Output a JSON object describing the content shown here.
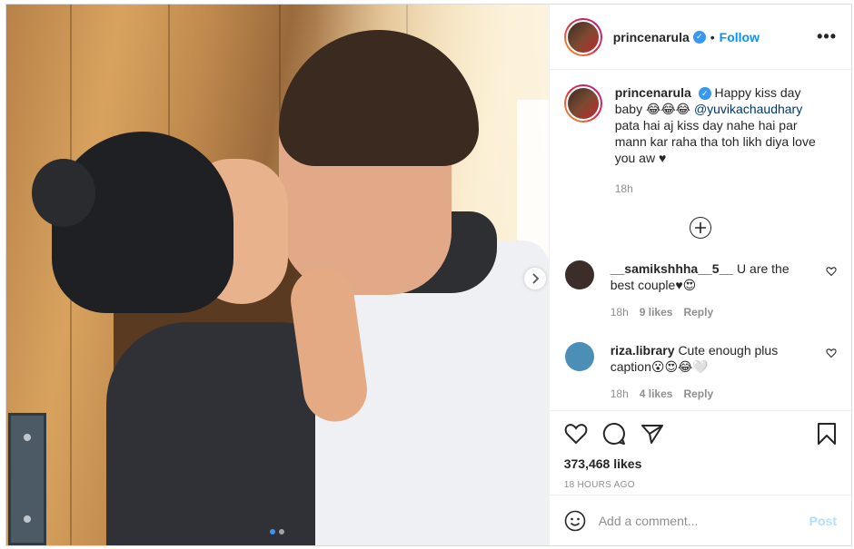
{
  "header": {
    "username": "princenarula",
    "separator": "•",
    "follow_label": "Follow",
    "more_icon": "more-horizontal-icon"
  },
  "caption": {
    "username": "princenarula",
    "text_before": "Happy kiss day baby 😂😂😂 ",
    "mention": "@yuvikachaudhary",
    "text_after": " pata hai aj kiss day nahe hai par mann kar raha tha toh likh diya love you aw ♥",
    "age": "18h"
  },
  "load_more_icon": "plus-circle-icon",
  "comments": [
    {
      "username": "__samikshhha__5__",
      "text": "U are the best couple♥😍",
      "age": "18h",
      "likes": "9 likes",
      "reply_label": "Reply",
      "avatar_color": "#3a2d2a"
    },
    {
      "username": "riza.library",
      "text": "Cute enough plus caption😮😍😂🤍",
      "age": "18h",
      "likes": "4 likes",
      "reply_label": "Reply",
      "avatar_color": "#4b8fb6"
    }
  ],
  "actions": {
    "likes": "373,468 likes",
    "timestamp": "18 HOURS AGO"
  },
  "add_comment": {
    "placeholder": "Add a comment...",
    "post_label": "Post"
  },
  "carousel": {
    "next_icon": "chevron-right-icon",
    "total_slides": 2,
    "active_slide": 1
  },
  "colors": {
    "accent": "#0095f6",
    "verified": "#3897f0",
    "post_disabled": "#b2dffc",
    "mention": "#00376b"
  }
}
